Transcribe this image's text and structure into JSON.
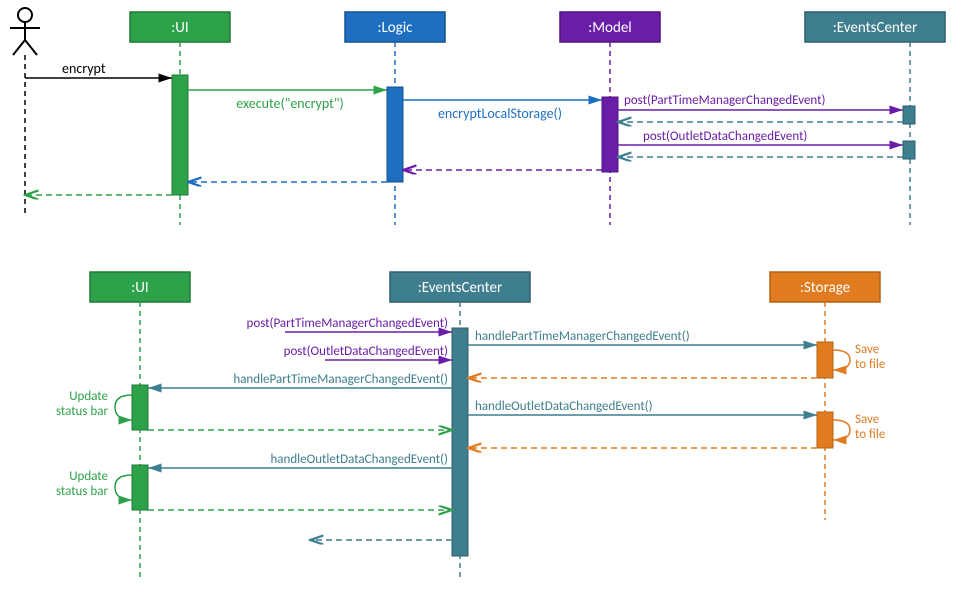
{
  "actors": {
    "user": "",
    "ui": ":UI",
    "logic": ":Logic",
    "model": ":Model",
    "events": ":EventsCenter",
    "storage": ":Storage"
  },
  "top": {
    "m_encrypt": "encrypt",
    "m_execute": "execute(\"encrypt\")",
    "m_encryptLocal": "encryptLocalStorage()",
    "m_postPTM": "post(PartTimeManagerChangedEvent)",
    "m_postODC": "post(OutletDataChangedEvent)"
  },
  "bottom": {
    "m_postPTM": "post(PartTimeManagerChangedEvent)",
    "m_postODC": "post(OutletDataChangedEvent)",
    "m_handlePTM_ui": "handlePartTimeManagerChangedEvent()",
    "m_handleODC_ui": "handleOutletDataChangedEvent()",
    "m_handlePTM_st": "handlePartTimeManagerChangedEvent()",
    "m_handleODC_st": "handleOutletDataChangedEvent()",
    "note_update1": "Update",
    "note_update1b": "status bar",
    "note_update2": "Update",
    "note_update2b": "status bar",
    "note_save1": "Save",
    "note_save1b": "to file",
    "note_save2": "Save",
    "note_save2b": "to file"
  },
  "colors": {
    "green": "#2ea24a",
    "greenDark": "#1e7a36",
    "blue": "#1e6fc1",
    "blueDark": "#14528f",
    "purple": "#6a1ea8",
    "purpleDark": "#4e1580",
    "teal": "#3e7e8e",
    "tealDark": "#2e5f6c",
    "orange": "#e07b1f",
    "orangeDark": "#b56016",
    "black": "#000"
  }
}
